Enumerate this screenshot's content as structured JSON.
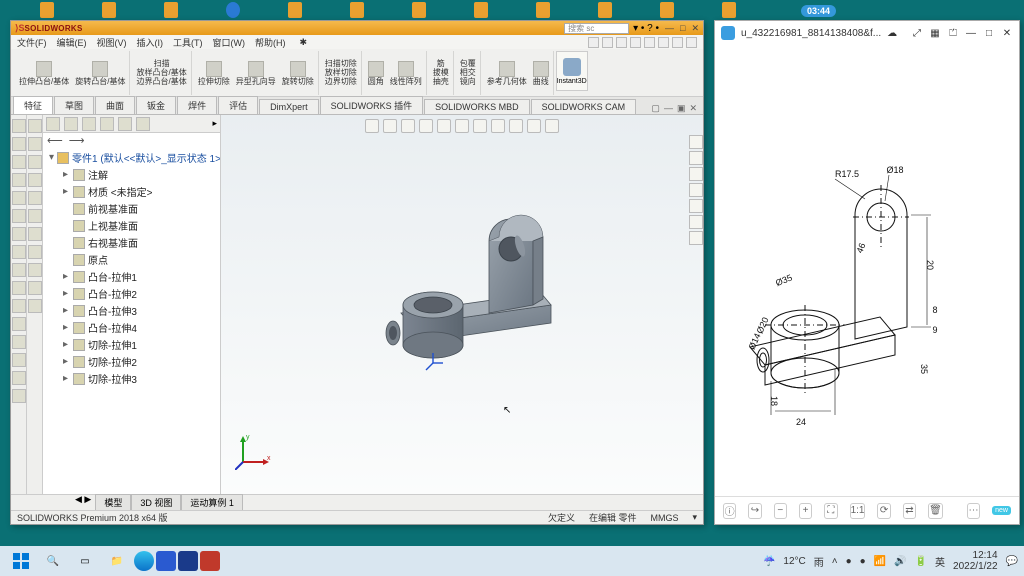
{
  "domain": "Computer-Use",
  "sw": {
    "brand": "SOLIDWORKS",
    "menus": [
      "文件(F)",
      "编辑(E)",
      "视图(V)",
      "插入(I)",
      "工具(T)",
      "窗口(W)",
      "帮助(H)"
    ],
    "search_placeholder": "搜索 sc",
    "ribbon": {
      "g1a": "拉伸凸台/基体",
      "g1b": "旋转凸台/基体",
      "g2a": "扫描",
      "g2b": "放样凸台/基体",
      "g2c": "边界凸台/基体",
      "g3a": "拉伸切除",
      "g3b": "异型孔向导",
      "g3c": "旋转切除",
      "g4a": "扫描切除",
      "g4b": "放样切除",
      "g4c": "边界切除",
      "g5a": "圆角",
      "g5b": "线性阵列",
      "g6a": "筋",
      "g6b": "拔模",
      "g6c": "抽壳",
      "g7a": "包覆",
      "g7b": "相交",
      "g7c": "镜向",
      "g8a": "参考几何体",
      "g8b": "曲线",
      "instant3d": "Instant3D"
    },
    "tabs": [
      "特征",
      "草图",
      "曲面",
      "钣金",
      "焊件",
      "评估",
      "DimXpert",
      "SOLIDWORKS 插件",
      "SOLIDWORKS MBD",
      "SOLIDWORKS CAM"
    ],
    "tree": {
      "root": "零件1 (默认<<默认>_显示状态 1>)",
      "items": [
        {
          "lv": 1,
          "pm": "▸",
          "label": "注解"
        },
        {
          "lv": 1,
          "pm": "▸",
          "label": "材质 <未指定>"
        },
        {
          "lv": 1,
          "pm": "",
          "label": "前视基准面"
        },
        {
          "lv": 1,
          "pm": "",
          "label": "上视基准面"
        },
        {
          "lv": 1,
          "pm": "",
          "label": "右视基准面"
        },
        {
          "lv": 1,
          "pm": "",
          "label": "原点"
        },
        {
          "lv": 1,
          "pm": "▸",
          "label": "凸台-拉伸1"
        },
        {
          "lv": 1,
          "pm": "▸",
          "label": "凸台-拉伸2"
        },
        {
          "lv": 1,
          "pm": "▸",
          "label": "凸台-拉伸3"
        },
        {
          "lv": 1,
          "pm": "▸",
          "label": "凸台-拉伸4"
        },
        {
          "lv": 1,
          "pm": "▸",
          "label": "切除-拉伸1"
        },
        {
          "lv": 1,
          "pm": "▸",
          "label": "切除-拉伸2"
        },
        {
          "lv": 1,
          "pm": "▸",
          "label": "切除-拉伸3"
        }
      ]
    },
    "bottom_tabs": [
      "模型",
      "3D 视图",
      "运动算例 1"
    ],
    "status": {
      "product": "SOLIDWORKS Premium 2018 x64 版",
      "s1": "欠定义",
      "s2": "在编辑 零件",
      "s3": "MMGS"
    }
  },
  "viewer": {
    "title": "u_432216981_8814138408&f...",
    "drawing_dims": [
      "R17.5",
      "Ø18",
      "46",
      "20",
      "Ø35",
      "8",
      "9",
      "Ø20",
      "Ø14",
      "35",
      "24",
      "18"
    ]
  },
  "clock_widget": "03:44",
  "taskbar": {
    "weather_temp": "12°C",
    "weather_txt": "雨",
    "time": "12:14",
    "date": "2022/1/22",
    "ime": "英"
  }
}
